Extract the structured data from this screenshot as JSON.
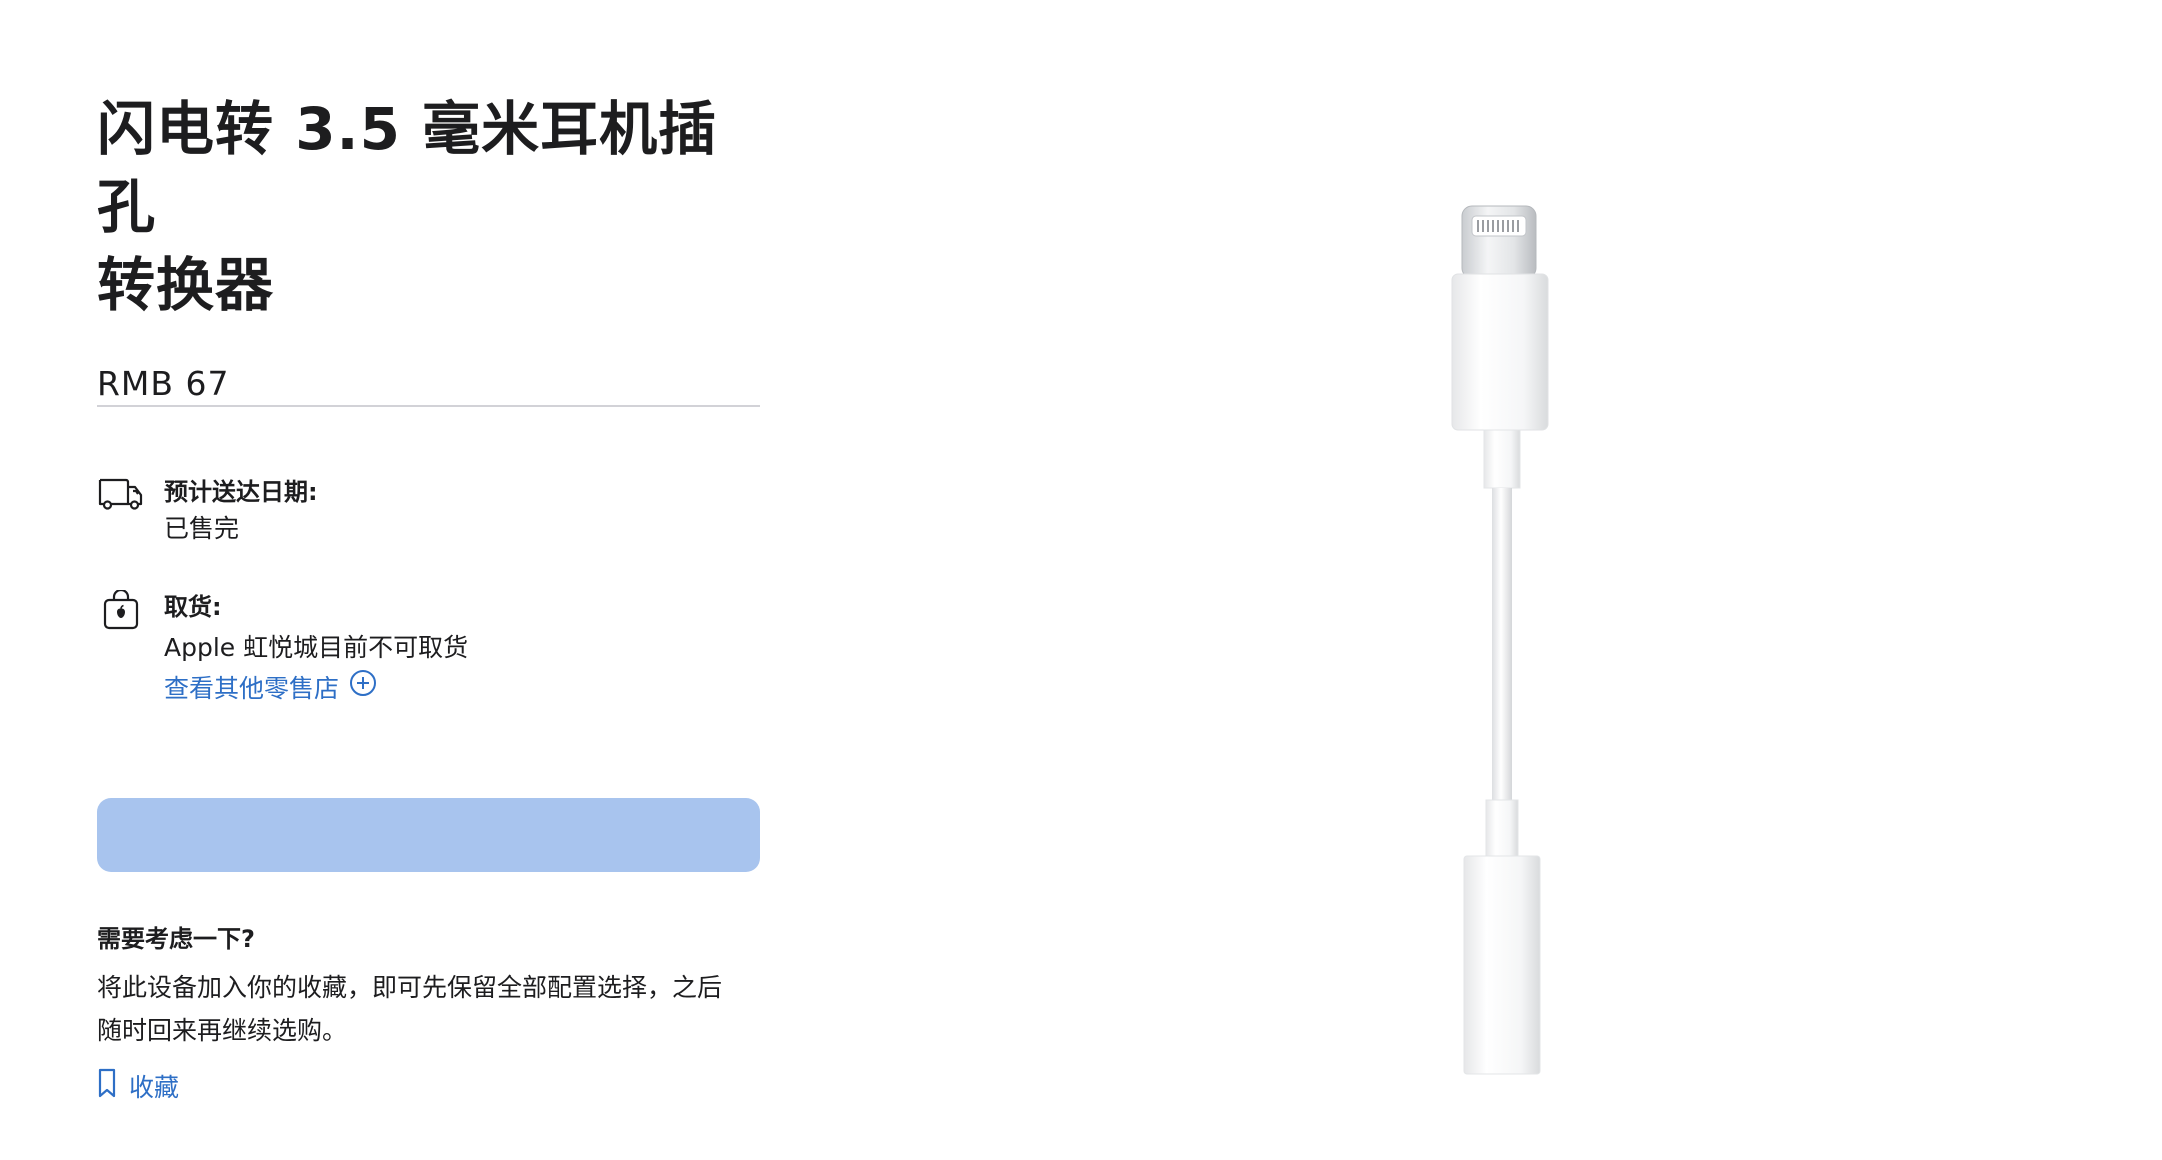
{
  "product": {
    "title_line1": "闪电转 3.5 毫米耳机插孔",
    "title_line2": "转换器",
    "price": "RMB 67"
  },
  "delivery": {
    "icon": "truck-icon",
    "label": "预计送达日期:",
    "value": "已售完"
  },
  "pickup": {
    "icon": "apple-bag-icon",
    "label": "取货:",
    "value": "Apple 虹悦城目前不可取货",
    "link": "查看其他零售店",
    "link_icon": "plus-circle-icon"
  },
  "add_to_bag": {
    "label": "",
    "color": "#a8c4ee"
  },
  "consider": {
    "title": "需要考虑一下?",
    "body_line1": "将此设备加入你的收藏，即可先保留全部配置选择，之后",
    "body_line2": "随时回来再继续选购。"
  },
  "save": {
    "icon": "bookmark-icon",
    "label": "收藏"
  },
  "colors": {
    "link": "#2e6fc6",
    "text": "#1d1d1f",
    "divider": "#d2d2d7"
  }
}
